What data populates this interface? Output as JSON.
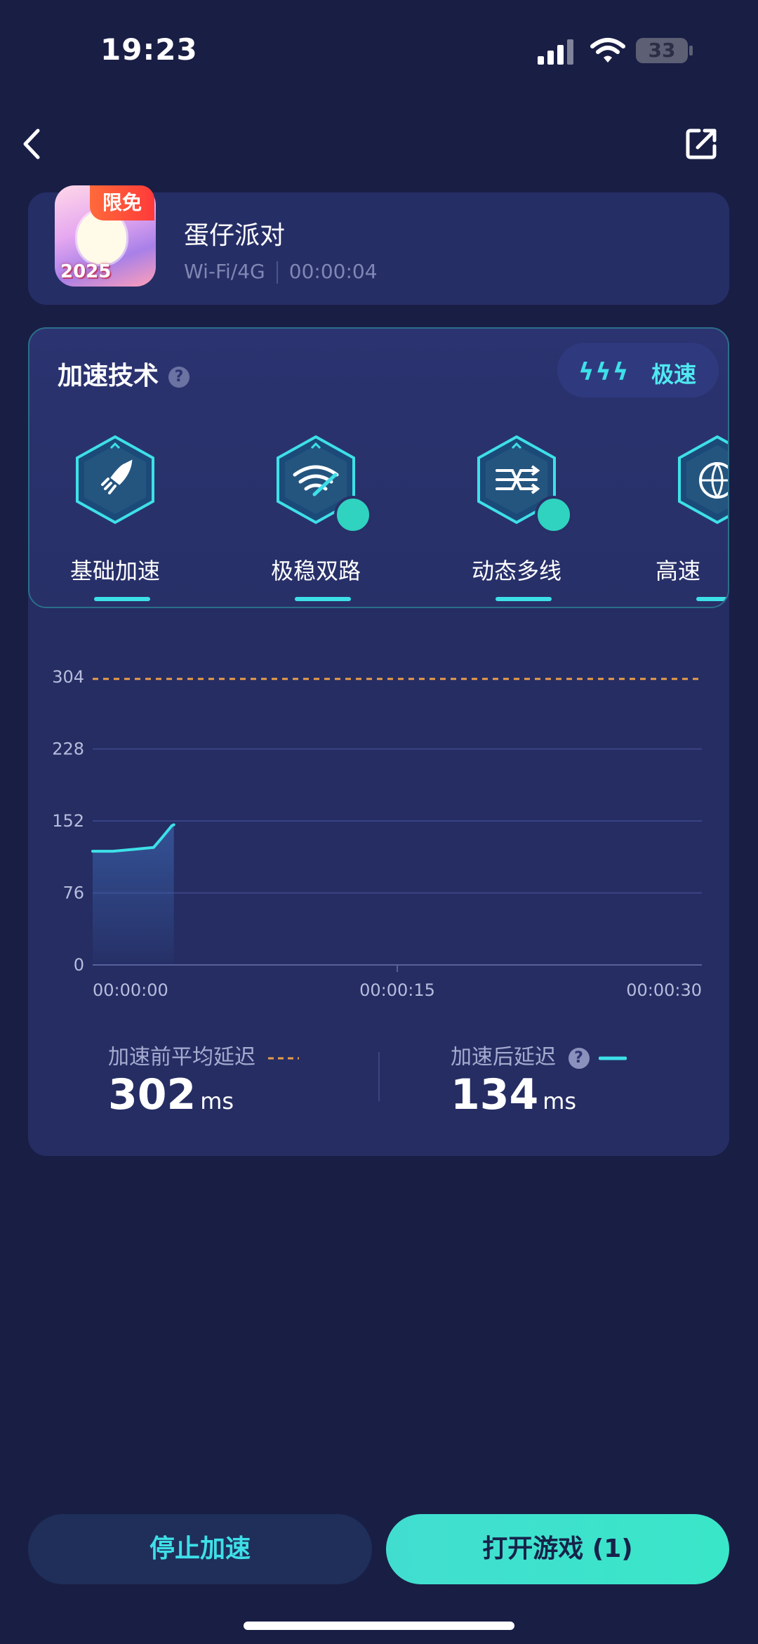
{
  "status_bar": {
    "time": "19:23",
    "battery": "33"
  },
  "game": {
    "name": "蛋仔派对",
    "badge": "限免",
    "icon_text": "2025",
    "network": "Wi-Fi/4G",
    "elapsed": "00:00:04"
  },
  "tech": {
    "title": "加速技术",
    "mode_label": "极速",
    "items": [
      {
        "label": "基础加速",
        "icon": "rocket-icon",
        "premium": false
      },
      {
        "label": "极稳双路",
        "icon": "wifi-dual-icon",
        "premium": true
      },
      {
        "label": "动态多线",
        "icon": "multiline-icon",
        "premium": true
      },
      {
        "label": "高速",
        "icon": "globe-icon",
        "premium": false
      }
    ]
  },
  "chart_data": {
    "type": "line",
    "y_ticks": [
      "304",
      "228",
      "152",
      "76",
      "0"
    ],
    "x_ticks": [
      "00:00:00",
      "00:00:15",
      "00:00:30"
    ],
    "ylim": [
      0,
      304
    ],
    "xlim_seconds": [
      0,
      30
    ],
    "baseline": {
      "name": "加速前平均延迟",
      "value": 302,
      "style": "dashed",
      "color": "#e79b4a"
    },
    "series": [
      {
        "name": "加速后延迟",
        "color": "#3ee0e8",
        "points": [
          [
            0,
            120
          ],
          [
            1,
            120
          ],
          [
            2,
            122
          ],
          [
            3,
            124
          ],
          [
            3.4,
            134
          ],
          [
            3.9,
            147
          ],
          [
            4,
            148
          ]
        ]
      }
    ],
    "grid": true
  },
  "stats": {
    "before_label": "加速前平均延迟",
    "before_value": "302",
    "before_unit": "ms",
    "after_label": "加速后延迟",
    "after_value": "134",
    "after_unit": "ms"
  },
  "buttons": {
    "stop": "停止加速",
    "open": "打开游戏 (1)"
  }
}
